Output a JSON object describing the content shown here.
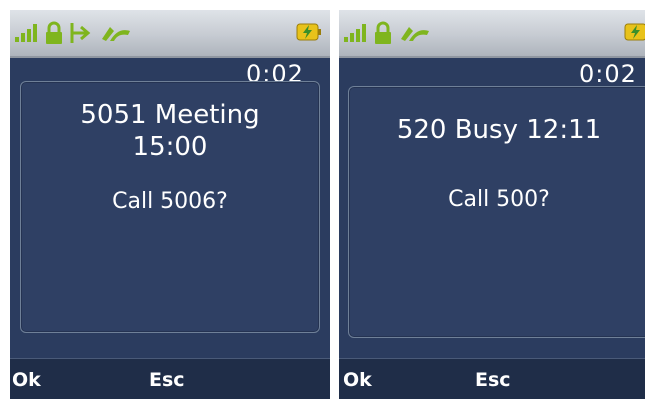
{
  "screens": [
    {
      "status_icons": [
        "signal-strength-icon",
        "lock-icon",
        "call-forward-icon",
        "handset-icon",
        "battery-charging-icon"
      ],
      "timer": "0:02",
      "dialog": {
        "title_line1": "5051 Meeting",
        "title_line2": "15:00",
        "prompt": "Call 5006?"
      },
      "softkeys": {
        "left": "Ok",
        "middle": "Esc"
      }
    },
    {
      "status_icons": [
        "signal-strength-icon",
        "lock-icon",
        "handset-icon",
        "battery-charging-icon"
      ],
      "timer": "0:02",
      "dialog": {
        "title_line1": "520 Busy 12:11",
        "prompt": "Call 500?"
      },
      "softkeys": {
        "left": "Ok",
        "middle": "Esc"
      }
    }
  ],
  "colors": {
    "screen_bg": "#2b3c5f",
    "dialog_bg": "#2f4064",
    "softkey_bar": "#1f2d48",
    "signal_green": "#7fb51e",
    "battery_yellow": "#e8c21a"
  }
}
